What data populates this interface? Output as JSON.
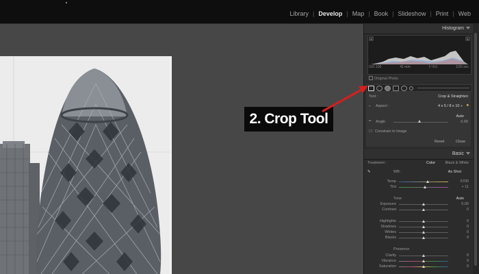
{
  "nav": {
    "modules": [
      {
        "label": "Library",
        "active": false
      },
      {
        "label": "Develop",
        "active": true
      },
      {
        "label": "Map",
        "active": false
      },
      {
        "label": "Book",
        "active": false
      },
      {
        "label": "Slideshow",
        "active": false
      },
      {
        "label": "Print",
        "active": false
      },
      {
        "label": "Web",
        "active": false
      }
    ]
  },
  "histogram": {
    "title": "Histogram",
    "iso": "ISO 100",
    "focal": "41 mm",
    "aperture": "f / 8.0",
    "shutter": "1/20 sec",
    "original_photo": "Original Photo"
  },
  "crop": {
    "tool_label": "Tool :",
    "tool_name": "Crop & Straighten",
    "aspect_label": "Aspect :",
    "aspect_value": "4 x 5 / 8 x 10 ÷",
    "auto_label": "Auto",
    "angle_label": "Angle",
    "angle_value": "0.00",
    "constrain_label": "Constrain to Image",
    "reset_label": "Reset",
    "close_label": "Close"
  },
  "basic": {
    "title": "Basic",
    "treatment_label": "Treatment :",
    "color_label": "Color",
    "bw_label": "Black & White",
    "wb_label": "WB :",
    "wb_value": "As Shot",
    "temp_label": "Temp",
    "temp_value": "6700",
    "tint_label": "Tint",
    "tint_value": "+ 11",
    "tone_label": "Tone",
    "tone_auto": "Auto",
    "exposure_label": "Exposure",
    "exposure_value": "0.00",
    "contrast_label": "Contrast",
    "contrast_value": "0",
    "highlights_label": "Highlights",
    "highlights_value": "0",
    "shadows_label": "Shadows",
    "shadows_value": "0",
    "whites_label": "Whites",
    "whites_value": "0",
    "blacks_label": "Blacks",
    "blacks_value": "0",
    "presence_label": "Presence",
    "clarity_label": "Clarity",
    "clarity_value": "0",
    "vibrance_label": "Vibrance",
    "vibrance_value": "0",
    "saturation_label": "Saturation",
    "saturation_value": "0"
  },
  "annotation": {
    "callout": "2. Crop Tool",
    "arrow_color": "#d61f1f"
  }
}
